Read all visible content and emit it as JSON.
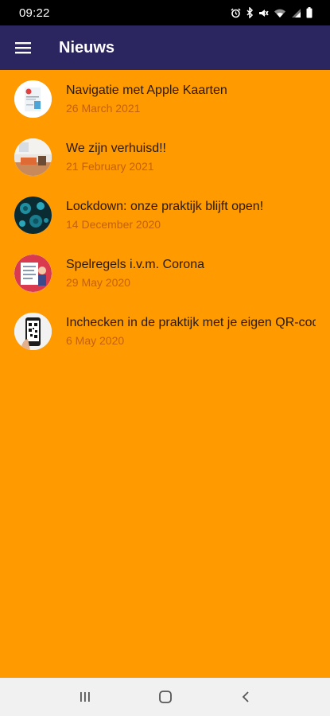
{
  "status_bar": {
    "time": "09:22",
    "icons": [
      "alarm-icon",
      "bluetooth-icon",
      "mute-icon",
      "wifi-icon",
      "signal-icon",
      "battery-icon"
    ]
  },
  "app_bar": {
    "title": "Nieuws",
    "menu_icon": "hamburger-menu-icon",
    "background": "#2b2560"
  },
  "colors": {
    "content_background": "#ff9a00",
    "title_text": "#2a1a06",
    "date_text": "#c4620a"
  },
  "news": [
    {
      "title": "Navigatie met Apple Kaarten",
      "date": "26 March 2021",
      "thumbnail": "map-thumbnail"
    },
    {
      "title": "We zijn verhuisd!!",
      "date": "21 February 2021",
      "thumbnail": "room-thumbnail"
    },
    {
      "title": "Lockdown: onze praktijk blijft open!",
      "date": "14 December 2020",
      "thumbnail": "virus-thumbnail"
    },
    {
      "title": "Spelregels i.v.m. Corona",
      "date": "29 May 2020",
      "thumbnail": "rules-thumbnail"
    },
    {
      "title": "Inchecken in de praktijk met je eigen QR-code",
      "date": "6 May 2020",
      "thumbnail": "qr-phone-thumbnail"
    }
  ],
  "nav_bar": {
    "buttons": [
      "recent-apps-icon",
      "home-icon",
      "back-icon"
    ]
  }
}
